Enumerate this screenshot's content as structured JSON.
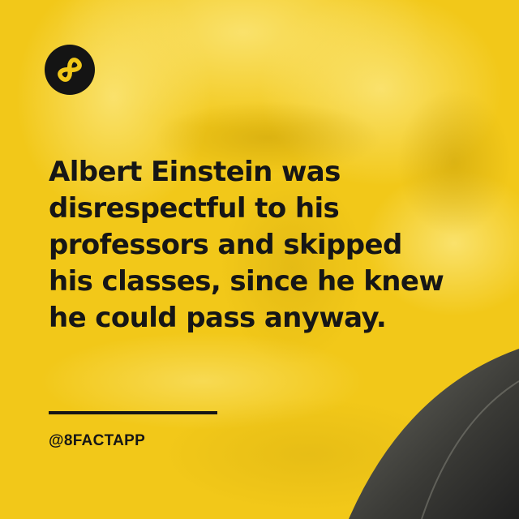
{
  "logo": {
    "icon": "infinity-8-icon",
    "background_color": "#141414",
    "icon_color": "#f2c819"
  },
  "fact": {
    "lines": [
      "Albert Einstein was",
      "disrespectful to his",
      "professors and skipped",
      "his classes, since he knew",
      "he could pass anyway."
    ]
  },
  "footer": {
    "handle": "@8FACTAPP"
  },
  "colors": {
    "background": "#f2c819",
    "text": "#161616",
    "corner_photo": "#3a3a36"
  }
}
